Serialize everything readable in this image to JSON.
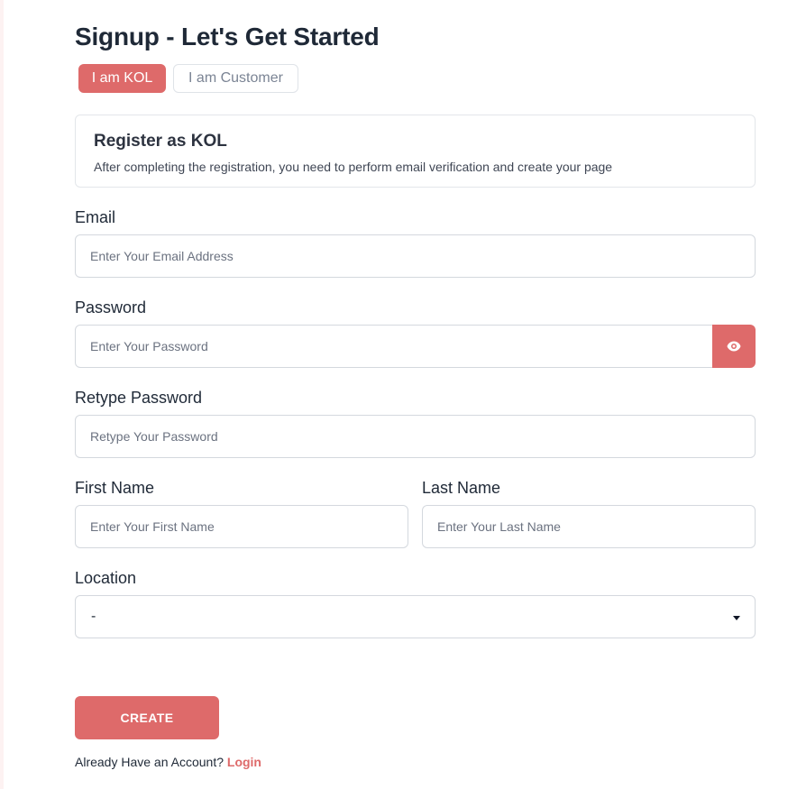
{
  "page": {
    "title": "Signup - Let's Get Started"
  },
  "tabs": [
    {
      "label": "I am KOL",
      "active": true
    },
    {
      "label": "I am Customer",
      "active": false
    }
  ],
  "info_card": {
    "title": "Register as KOL",
    "description": "After completing the registration, you need to perform email verification and create your page"
  },
  "form": {
    "email": {
      "label": "Email",
      "placeholder": "Enter Your Email Address",
      "value": ""
    },
    "password": {
      "label": "Password",
      "placeholder": "Enter Your Password",
      "value": "",
      "toggle_icon": "eye-icon"
    },
    "retype_password": {
      "label": "Retype Password",
      "placeholder": "Retype Your Password",
      "value": ""
    },
    "first_name": {
      "label": "First Name",
      "placeholder": "Enter Your First Name",
      "value": ""
    },
    "last_name": {
      "label": "Last Name",
      "placeholder": "Enter Your Last Name",
      "value": ""
    },
    "location": {
      "label": "Location",
      "selected": "-",
      "icon": "caret-down-icon"
    }
  },
  "actions": {
    "create_label": "CREATE"
  },
  "footer": {
    "prompt": "Already Have an Account?",
    "login_label": "Login"
  },
  "colors": {
    "accent": "#de6a6a",
    "text": "#1f2937",
    "border": "#d4d8de",
    "muted": "#6b7280"
  }
}
